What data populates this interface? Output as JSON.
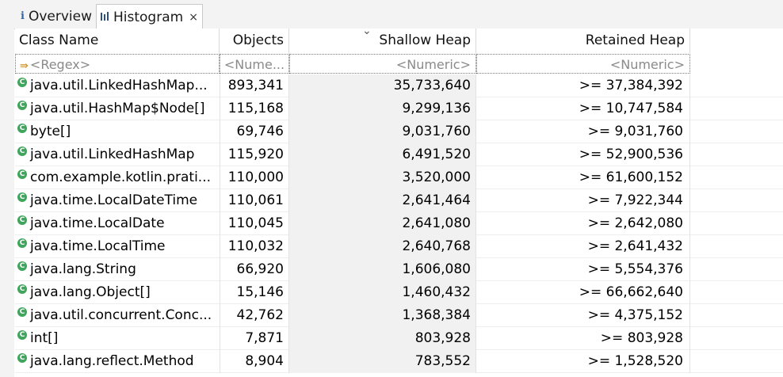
{
  "tabs": [
    {
      "label": "Overview",
      "icon": "info-icon",
      "glyph": "i"
    },
    {
      "label": "Histogram",
      "icon": "bar-chart-icon",
      "glyph": "▐▐▌",
      "close": "×"
    }
  ],
  "columns": {
    "class_name": "Class Name",
    "objects": "Objects",
    "shallow_heap": "Shallow Heap",
    "retained_heap": "Retained Heap",
    "sort_indicator": "⌄"
  },
  "filters": {
    "class_name": "<Regex>",
    "objects": "<Nume...",
    "shallow_heap": "<Numeric>",
    "retained_heap": "<Numeric>"
  },
  "rows": [
    {
      "name": "java.util.LinkedHashMap...",
      "objects": "893,341",
      "shallow": "35,733,640",
      "retained": ">= 37,384,392"
    },
    {
      "name": "java.util.HashMap$Node[]",
      "objects": "115,168",
      "shallow": "9,299,136",
      "retained": ">= 10,747,584"
    },
    {
      "name": "byte[]",
      "objects": "69,746",
      "shallow": "9,031,760",
      "retained": ">= 9,031,760"
    },
    {
      "name": "java.util.LinkedHashMap",
      "objects": "115,920",
      "shallow": "6,491,520",
      "retained": ">= 52,900,536"
    },
    {
      "name": "com.example.kotlin.prati...",
      "objects": "110,000",
      "shallow": "3,520,000",
      "retained": ">= 61,600,152"
    },
    {
      "name": "java.time.LocalDateTime",
      "objects": "110,061",
      "shallow": "2,641,464",
      "retained": ">= 7,922,344"
    },
    {
      "name": "java.time.LocalDate",
      "objects": "110,045",
      "shallow": "2,641,080",
      "retained": ">= 2,642,080"
    },
    {
      "name": "java.time.LocalTime",
      "objects": "110,032",
      "shallow": "2,640,768",
      "retained": ">= 2,641,432"
    },
    {
      "name": "java.lang.String",
      "objects": "66,920",
      "shallow": "1,606,080",
      "retained": ">= 5,554,376"
    },
    {
      "name": "java.lang.Object[]",
      "objects": "15,146",
      "shallow": "1,460,432",
      "retained": ">= 66,662,640"
    },
    {
      "name": "java.util.concurrent.Conc...",
      "objects": "42,762",
      "shallow": "1,368,384",
      "retained": ">= 4,375,152"
    },
    {
      "name": "int[]",
      "objects": "7,871",
      "shallow": "803,928",
      "retained": ">= 803,928"
    },
    {
      "name": "java.lang.reflect.Method",
      "objects": "8,904",
      "shallow": "783,552",
      "retained": ">= 1,528,520"
    }
  ]
}
